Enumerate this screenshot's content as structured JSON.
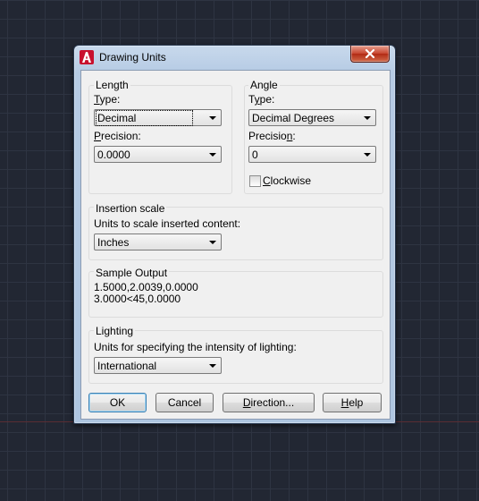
{
  "window": {
    "title": "Drawing Units",
    "close_icon": "close-icon",
    "app_icon": "autocad-icon"
  },
  "length": {
    "group_label": "Length",
    "type_label": "Type:",
    "type_value": "Decimal",
    "precision_label": "Precision:",
    "precision_value": "0.0000"
  },
  "angle": {
    "group_label": "Angle",
    "type_label": "Type:",
    "type_value": "Decimal Degrees",
    "precision_label": "Precision:",
    "precision_value": "0",
    "clockwise_label": "Clockwise",
    "clockwise_checked": false
  },
  "insertion": {
    "group_label": "Insertion scale",
    "units_label": "Units to scale inserted content:",
    "units_value": "Inches"
  },
  "sample": {
    "group_label": "Sample Output",
    "line1": "1.5000,2.0039,0.0000",
    "line2": "3.0000<45,0.0000"
  },
  "lighting": {
    "group_label": "Lighting",
    "units_label": "Units for specifying the intensity of lighting:",
    "units_value": "International"
  },
  "buttons": {
    "ok": "OK",
    "cancel": "Cancel",
    "direction": "Direction...",
    "help": "Help"
  }
}
